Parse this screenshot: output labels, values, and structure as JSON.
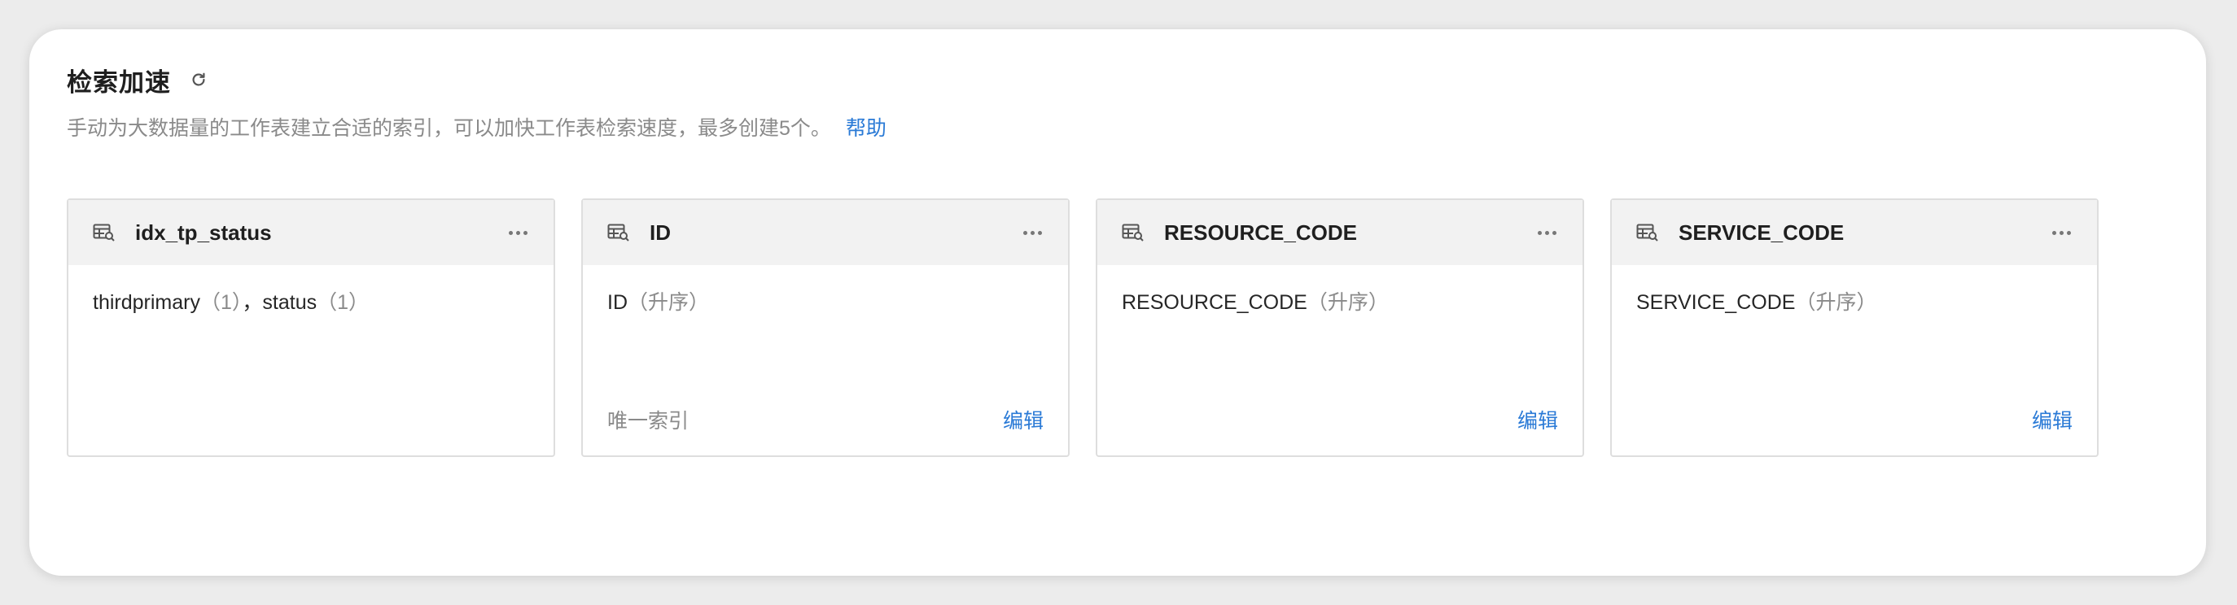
{
  "header": {
    "title": "检索加速",
    "description": "手动为大数据量的工作表建立合适的索引，可以加快工作表检索速度，最多创建5个。",
    "help_label": "帮助"
  },
  "indexes": [
    {
      "name": "idx_tp_status",
      "fields": [
        {
          "field": "thirdprimary",
          "suffix": "（1）"
        },
        {
          "sep": "，"
        },
        {
          "field": "status",
          "suffix": "（1）"
        }
      ]
    },
    {
      "name": "ID",
      "fields": [
        {
          "field": "ID",
          "suffix": "（升序）"
        }
      ],
      "unique_label": "唯一索引",
      "edit_label": "编辑"
    },
    {
      "name": "RESOURCE_CODE",
      "fields": [
        {
          "field": "RESOURCE_CODE",
          "suffix": "（升序）"
        }
      ],
      "edit_label": "编辑"
    },
    {
      "name": "SERVICE_CODE",
      "fields": [
        {
          "field": "SERVICE_CODE",
          "suffix": "（升序）"
        }
      ],
      "edit_label": "编辑"
    }
  ],
  "icons": {
    "refresh": "refresh-icon",
    "table": "table-index-icon",
    "more": "more-icon"
  },
  "colors": {
    "accent": "#2a7ad6",
    "card_header": "#f2f2f2",
    "muted_text": "#8a8a8a"
  }
}
